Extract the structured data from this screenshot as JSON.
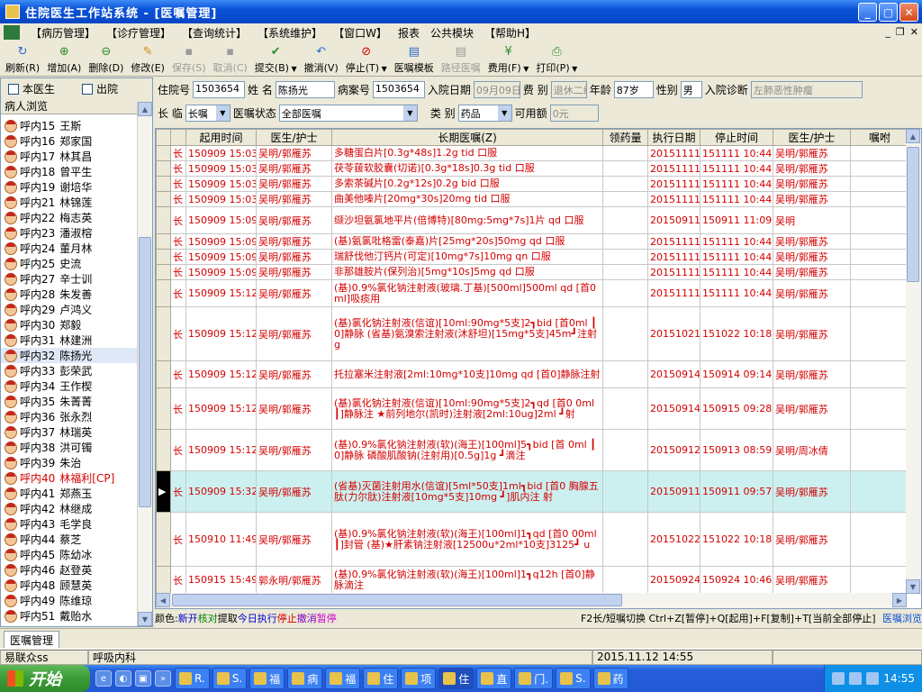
{
  "window": {
    "title": "住院医生工作站系统 - [医嘱管理]",
    "min": "_",
    "max": "▢",
    "close": "✕"
  },
  "menu": [
    "【病历管理】",
    "【诊疗管理】",
    "【查询统计】",
    "【系统维护】",
    "【窗口W】",
    "报表",
    "公共模块",
    "【帮助H】"
  ],
  "toolbar": [
    {
      "label": "刷新(R)",
      "icon": "↻",
      "color": "#2a6ad0",
      "enabled": true,
      "arrow": false
    },
    {
      "label": "增加(A)",
      "icon": "⊕",
      "color": "#2f8a2b",
      "enabled": true,
      "arrow": false
    },
    {
      "label": "删除(D)",
      "icon": "⊖",
      "color": "#2f8a2b",
      "enabled": true,
      "arrow": false
    },
    {
      "label": "修改(E)",
      "icon": "✎",
      "color": "#d08a1e",
      "enabled": true,
      "arrow": false
    },
    {
      "label": "保存(S)",
      "icon": "▪",
      "color": "#9a9a9a",
      "enabled": false,
      "arrow": false
    },
    {
      "label": "取消(C)",
      "icon": "▪",
      "color": "#9a9a9a",
      "enabled": false,
      "arrow": false
    },
    {
      "label": "提交(B)",
      "icon": "✔",
      "color": "#2f8a2b",
      "enabled": true,
      "arrow": true
    },
    {
      "label": "撤消(V)",
      "icon": "↶",
      "color": "#2a6ad0",
      "enabled": true,
      "arrow": false
    },
    {
      "label": "停止(T)",
      "icon": "⊘",
      "color": "#d40000",
      "enabled": true,
      "arrow": true
    },
    {
      "label": "医嘱模板",
      "icon": "▤",
      "color": "#2a6ad0",
      "enabled": true,
      "arrow": false
    },
    {
      "label": "路径医嘱",
      "icon": "▤",
      "color": "#9a9a9a",
      "enabled": false,
      "arrow": false
    },
    {
      "label": "费用(F)",
      "icon": "¥",
      "color": "#2f8a2b",
      "enabled": true,
      "arrow": true
    },
    {
      "label": "打印(P)",
      "icon": "⎙",
      "color": "#2f8a2b",
      "enabled": true,
      "arrow": true
    }
  ],
  "sidebar": {
    "chk_own": "本医生",
    "chk_out": "出院",
    "header": "病人浏览",
    "patients": [
      {
        "bed": "呼内15",
        "name": "王斯",
        "state": ""
      },
      {
        "bed": "呼内16",
        "name": "郑家国",
        "state": ""
      },
      {
        "bed": "呼内17",
        "name": "林其昌",
        "state": ""
      },
      {
        "bed": "呼内18",
        "name": "曾平生",
        "state": ""
      },
      {
        "bed": "呼内19",
        "name": "谢培华",
        "state": ""
      },
      {
        "bed": "呼内21",
        "name": "林锦莲",
        "state": ""
      },
      {
        "bed": "呼内22",
        "name": "梅志英",
        "state": ""
      },
      {
        "bed": "呼内23",
        "name": "潘淑榕",
        "state": ""
      },
      {
        "bed": "呼内24",
        "name": "董月林",
        "state": ""
      },
      {
        "bed": "呼内25",
        "name": "史流",
        "state": ""
      },
      {
        "bed": "呼内27",
        "name": "辛士训",
        "state": ""
      },
      {
        "bed": "呼内28",
        "name": "朱发善",
        "state": ""
      },
      {
        "bed": "呼内29",
        "name": "卢鸿义",
        "state": ""
      },
      {
        "bed": "呼内30",
        "name": "郑毅",
        "state": ""
      },
      {
        "bed": "呼内31",
        "name": "林建洲",
        "state": ""
      },
      {
        "bed": "呼内32",
        "name": "陈扬光",
        "state": "selected"
      },
      {
        "bed": "呼内33",
        "name": "彭荣武",
        "state": ""
      },
      {
        "bed": "呼内34",
        "name": "王作楔",
        "state": ""
      },
      {
        "bed": "呼内35",
        "name": "朱菁菁",
        "state": ""
      },
      {
        "bed": "呼内36",
        "name": "张永烈",
        "state": ""
      },
      {
        "bed": "呼内37",
        "name": "林瑞英",
        "state": ""
      },
      {
        "bed": "呼内38",
        "name": "洪可镯",
        "state": ""
      },
      {
        "bed": "呼内39",
        "name": "朱治",
        "state": ""
      },
      {
        "bed": "呼内40",
        "name": "林福利[CP]",
        "state": "red"
      },
      {
        "bed": "呼内41",
        "name": "郑燕玉",
        "state": ""
      },
      {
        "bed": "呼内42",
        "name": "林继成",
        "state": ""
      },
      {
        "bed": "呼内43",
        "name": "毛学良",
        "state": ""
      },
      {
        "bed": "呼内44",
        "name": "蔡芝",
        "state": ""
      },
      {
        "bed": "呼内45",
        "name": "陈幼冰",
        "state": ""
      },
      {
        "bed": "呼内46",
        "name": "赵登英",
        "state": ""
      },
      {
        "bed": "呼内48",
        "name": "顾慧英",
        "state": ""
      },
      {
        "bed": "呼内49",
        "name": "陈维琼",
        "state": ""
      },
      {
        "bed": "呼内51",
        "name": "戴贻水",
        "state": ""
      }
    ]
  },
  "info": {
    "admission_no_label": "住院号",
    "admission_no": "1503654",
    "name_label": "姓 名",
    "name": "陈扬光",
    "case_no_label": "病案号",
    "case_no": "1503654",
    "admit_date_label": "入院日期",
    "admit_date": "09月09日",
    "fee_type_label": "费 别",
    "fee_type": "退休二级",
    "age_label": "年龄",
    "age": "87岁",
    "sex_label": "性别",
    "sex": "男",
    "diagnosis_label": "入院诊断",
    "diagnosis": "左肺恶性肿瘤",
    "type_label": "长 临",
    "type_value": "长嘱",
    "status_label": "医嘱状态",
    "status_value": "全部医嘱",
    "category_label": "类 别",
    "category_value": "药品",
    "balance_label": "可用额",
    "balance_value": "0元"
  },
  "grid": {
    "headers": [
      "",
      "",
      "起用时间",
      "医生/护士",
      "长期医嘱(Z)",
      "领药量",
      "执行日期",
      "停止时间",
      "医生/护士",
      "嘱咐"
    ],
    "rows": [
      {
        "type": "长",
        "start": "150909 15:03",
        "doctor": "吴明/郭雁苏",
        "order": "多糖蛋白片[0.3g*48s]1.2g tid 口服",
        "exec": "20151111",
        "stop": "151111 10:44",
        "doctor2": "吴明/郭雁苏",
        "cur": false
      },
      {
        "type": "长",
        "start": "150909 15:03",
        "doctor": "吴明/郭雁苏",
        "order": "茯苓菝软胶囊(切诺)[0.3g*18s]0.3g tid 口服",
        "exec": "20151111",
        "stop": "151111 10:44",
        "doctor2": "吴明/郭雁苏",
        "cur": false
      },
      {
        "type": "长",
        "start": "150909 15:03",
        "doctor": "吴明/郭雁苏",
        "order": "多索茶碱片[0.2g*12s]0.2g bid 口服",
        "exec": "20151111",
        "stop": "151111 10:44",
        "doctor2": "吴明/郭雁苏",
        "cur": false
      },
      {
        "type": "长",
        "start": "150909 15:03",
        "doctor": "吴明/郭雁苏",
        "order": "曲美他嗪片[20mg*30s]20mg tid 口服",
        "exec": "20151111",
        "stop": "151111 10:44",
        "doctor2": "吴明/郭雁苏",
        "cur": false
      },
      {
        "type": "长",
        "start": "150909 15:09",
        "doctor": "吴明/郭雁苏",
        "order": "缬沙坦氨氯地平片(倍博特)[80mg:5mg*7s]1片 qd 口服",
        "exec": "20150911",
        "stop": "150911 11:09",
        "doctor2": "吴明",
        "cur": false
      },
      {
        "type": "长",
        "start": "150909 15:09",
        "doctor": "吴明/郭雁苏",
        "order": "(基)氨氯吡格雷(泰嘉)片[25mg*20s]50mg qd 口服",
        "exec": "20151111",
        "stop": "151111 10:44",
        "doctor2": "吴明/郭雁苏",
        "cur": false
      },
      {
        "type": "长",
        "start": "150909 15:09",
        "doctor": "吴明/郭雁苏",
        "order": "瑞舒伐他汀钙片(可定)[10mg*7s]10mg qn 口服",
        "exec": "20151111",
        "stop": "151111 10:44",
        "doctor2": "吴明/郭雁苏",
        "cur": false
      },
      {
        "type": "长",
        "start": "150909 15:09",
        "doctor": "吴明/郭雁苏",
        "order": "非那雄胺片(保列治)[5mg*10s]5mg qd 口服",
        "exec": "20151111",
        "stop": "151111 10:44",
        "doctor2": "吴明/郭雁苏",
        "cur": false
      },
      {
        "type": "长",
        "start": "150909 15:12",
        "doctor": "吴明/郭雁苏",
        "order": "(基)0.9%氯化钠注射液(玻璃.丁基)[500ml]500ml qd [首0ml]吸痰用",
        "exec": "20151111",
        "stop": "151111 10:44",
        "doctor2": "吴明/郭雁苏",
        "cur": false
      },
      {
        "type": "长",
        "start": "150909 15:12",
        "doctor": "吴明/郭雁苏",
        "order": "(基)氯化钠注射液(信谊)[10ml:90mg*5支]2┓bid [首0ml ┃0]静脉 (省基)氨溴索注射液(沐舒坦)[15mg*5支]45m┛注射 g",
        "exec": "20151021",
        "stop": "151022 10:18",
        "doctor2": "吴明/郭雁苏",
        "cur": false
      },
      {
        "type": "长",
        "start": "150909 15:12",
        "doctor": "吴明/郭雁苏",
        "order": "托拉塞米注射液[2ml:10mg*10支]10mg qd [首0]静脉注射",
        "exec": "20150914",
        "stop": "150914 09:14",
        "doctor2": "吴明/郭雁苏",
        "cur": false
      },
      {
        "type": "长",
        "start": "150909 15:12",
        "doctor": "吴明/郭雁苏",
        "order": "(基)氯化钠注射液(信谊)[10ml:90mg*5支]2┓qd [首0 0ml ┃]静脉注 ★前列地尔(凯时)注射液[2ml:10ug]2ml ┛射",
        "exec": "20150914",
        "stop": "150915 09:28",
        "doctor2": "吴明/郭雁苏",
        "cur": false
      },
      {
        "type": "长",
        "start": "150909 15:12",
        "doctor": "吴明/郭雁苏",
        "order": "(基)0.9%氯化钠注射液(软)(海王)[100ml]5┓bid [首 0ml ┃0]静脉 磷酸肌酸钠(注射用)[0.5g]1g ┛滴注",
        "exec": "20150912",
        "stop": "150913 08:59",
        "doctor2": "吴明/周冰倩",
        "cur": false
      },
      {
        "type": "长",
        "start": "150909 15:32",
        "doctor": "吴明/郭雁苏",
        "order": "(省基)灭菌注射用水(信谊)[5ml*50支]1ml┓bid [首0 胸腺五肽(力尔肽)注射液[10mg*5支]10mg ┛]肌内注 射",
        "exec": "20150911",
        "stop": "150911 09:57",
        "doctor2": "吴明/郭雁苏",
        "cur": true
      },
      {
        "type": "长",
        "start": "150910 11:49",
        "doctor": "吴明/郭雁苏",
        "order": "(基)0.9%氯化钠注射液(软)(海王)[100ml]1┓qd [首0 00ml ┃]封管 (基)★肝素钠注射液[12500u*2ml*10支]3125┛ u",
        "exec": "20151022",
        "stop": "151022 10:18",
        "doctor2": "吴明/郭雁苏",
        "cur": false
      },
      {
        "type": "长",
        "start": "150915 15:49",
        "doctor": "郭永明/郭雁苏",
        "order": "(基)0.9%氯化钠注射液(软)(海王)[100ml]1┓q12h [首0]静脉滴注",
        "exec": "20150924",
        "stop": "150924 10:46",
        "doctor2": "吴明/郭雁苏",
        "cur": false
      }
    ]
  },
  "legend": {
    "prefix": "颜色:",
    "items": [
      {
        "text": "新开",
        "color": "#0000d0"
      },
      {
        "text": "核对",
        "color": "#008000"
      },
      {
        "text": "提取",
        "color": "#000000"
      },
      {
        "text": "今日执行",
        "color": "#0000d0"
      },
      {
        "text": "停止",
        "color": "#d40000"
      },
      {
        "text": "撤消",
        "color": "#8000c0"
      },
      {
        "text": "暂停",
        "color": "#d000d0"
      }
    ],
    "shortcuts": "F2长/短嘱切换 Ctrl+Z[暂停]+Q[起用]+F[复制]+T[当前全部停止]",
    "browse": "医嘱浏览"
  },
  "tab": "医嘱管理",
  "status": {
    "user": "易联众ss",
    "dept": "呼吸内科",
    "datetime": "2015.11.12 14:55"
  },
  "taskbar": {
    "start": "开始",
    "quicklaunch": [
      "e",
      "◐",
      "▣",
      "»"
    ],
    "tasks": [
      "R.",
      "S.",
      "福",
      "病",
      "福",
      "住",
      "项",
      "住",
      "直",
      "门.",
      "S.",
      "药"
    ],
    "active_task": 7,
    "clock": "14:55"
  },
  "colors": {
    "accent": "#0a52d8",
    "order_red": "#d40000",
    "current_row": "#ccf0f0"
  }
}
